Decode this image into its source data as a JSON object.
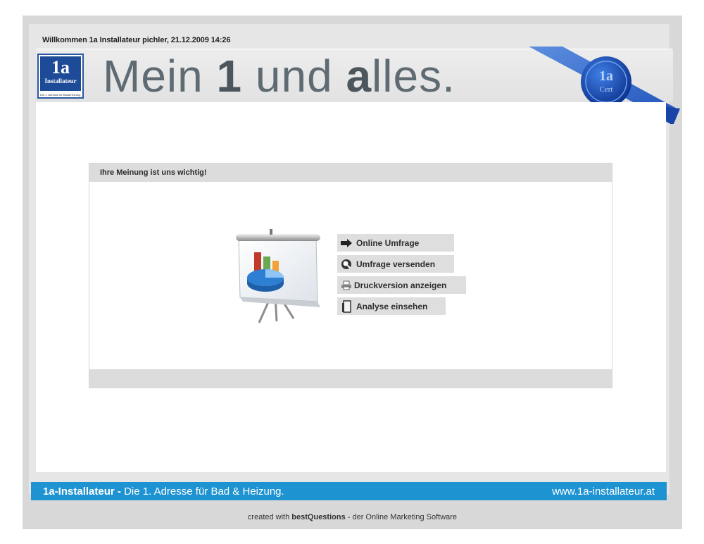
{
  "header": {
    "welcome_text": "Willkommen 1a Installateur pichler, 21.12.2009 14:26"
  },
  "logo": {
    "big": "1a",
    "small": "Installateur",
    "tagline": "Die 1. Adresse für Bad&Heizung"
  },
  "slogan": {
    "part1": "Mein ",
    "part2": "1",
    "part3": " und ",
    "part4": "a",
    "part5": "lles."
  },
  "seal": {
    "top": "1a",
    "bottom": "Cert"
  },
  "panel": {
    "title": "Ihre Meinung ist uns wichtig!"
  },
  "actions": [
    {
      "label": "Online Umfrage",
      "icon": "arrow-right-icon"
    },
    {
      "label": "Umfrage versenden",
      "icon": "mail-search-icon"
    },
    {
      "label": "Druckversion anzeigen",
      "icon": "print-icon"
    },
    {
      "label": "Analyse einsehen",
      "icon": "document-icon"
    }
  ],
  "footer": {
    "brand": "1a-Installateur",
    "separator": " - ",
    "tagline": " Die 1. Adresse für Bad & Heizung.",
    "url": "www.1a-installateur.at"
  },
  "credit": {
    "prefix": "created with ",
    "product": "bestQuestions",
    "suffix": " - der Online Marketing Software"
  },
  "colors": {
    "accent_blue": "#1e93d2",
    "logo_blue": "#1d4b98",
    "frame_gray": "#d8d8d8"
  }
}
